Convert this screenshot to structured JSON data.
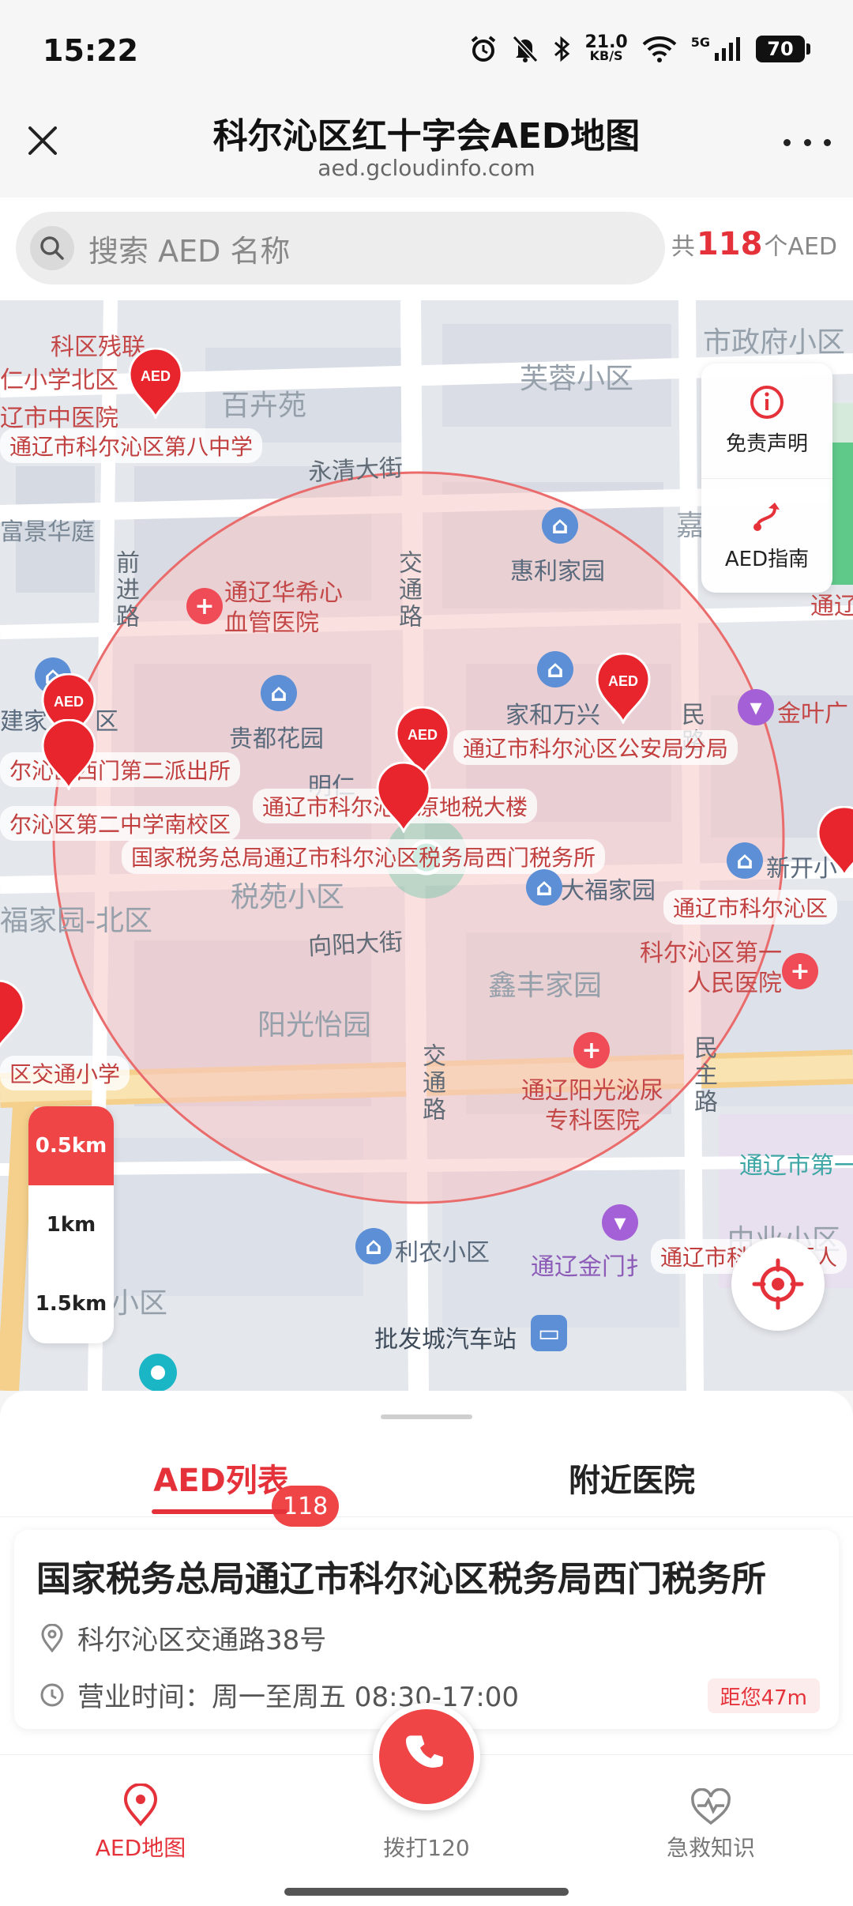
{
  "status_bar": {
    "time": "15:22",
    "net_speed_value": "21.0",
    "net_speed_unit": "KB/S",
    "network": "5G",
    "battery": "70",
    "icons": [
      "alarm-icon",
      "mute-icon",
      "bluetooth-icon",
      "wifi-icon",
      "signal-icon",
      "battery-icon"
    ]
  },
  "header": {
    "title": "科尔沁区红十字会AED地图",
    "url": "aed.gcloudinfo.com"
  },
  "search": {
    "placeholder": "搜索 AED 名称",
    "count_prefix": "共",
    "count": "118",
    "count_suffix": "个AED"
  },
  "map": {
    "labels": {
      "kequ_canlian": "科区残联",
      "ren_xiaoxue": "仁小学北区",
      "zhongyiyuan": "辽市中医院",
      "bazhong": "通辽市科尔沁区第八中学",
      "baihuiyuan": "百卉苑",
      "furong": "芙蓉小区",
      "shizhengfu": "市政府小区",
      "yongqing": "永清大街",
      "fujing": "富景华庭",
      "qianjinlu": "前进路",
      "jiaotonglu_1": "交通路",
      "huili": "惠利家园",
      "jia": "嘉",
      "tongliao_right": "通辽",
      "huaxi_hospital": "通辽华希心血管医院",
      "jiahe": "家和万兴",
      "minlu": "民路",
      "jinyeguang": "金叶广",
      "jianjia": "建家",
      "guidu": "贵都花园",
      "chaqu": "区",
      "ximen_pcs": "尔沁区西门第二派出所",
      "gongan": "通辽市科尔沁区公安局分局",
      "erzhong": "尔沁区第二中学南校区",
      "didashui": "通辽市科尔沁区原地税大楼",
      "mingren": "明仁",
      "shuiwusuo": "国家税务总局通辽市科尔沁区税务局西门税务所",
      "xinkai": "新开小",
      "shuiyuan": "税苑小区",
      "dafu": "大福家园",
      "fujia_north": "福家园-北区",
      "kerqin_right": "通辽市科尔沁区",
      "xiangyang": "向阳大街",
      "diyi_hospital": "科尔沁区第一人民医院",
      "xinfeng": "鑫丰家园",
      "yangguangyi": "阳光怡园",
      "jiaotong_xiaoxue": "区交通小学",
      "jiaotonglu_2": "交通路",
      "minzhulu": "民主路",
      "miniao": "通辽阳光泌尿专科医院",
      "tongliao_di": "通辽市第一",
      "youyi": "由业小区",
      "linong": "利农小区",
      "jinmen": "通辽金门扌",
      "kerqin_ren": "通辽市科尔沁区人",
      "pifa": "批发城汽车站",
      "xiaoqu_left": "小区"
    },
    "side_panel": {
      "disclaimer": "免责声明",
      "guide": "AED指南"
    },
    "ranges": [
      "0.5km",
      "1km",
      "1.5km"
    ],
    "active_range": "0.5km",
    "pin_label": "AED",
    "colors": {
      "accent": "#E5323A",
      "circle_fill": "#F7C7C7",
      "road": "#FFFFFF",
      "highway": "#F9D48A"
    }
  },
  "sheet": {
    "tabs": [
      "AED列表",
      "附近医院"
    ],
    "active_tab": "AED列表",
    "badge": "118",
    "item": {
      "name": "国家税务总局通辽市科尔沁区税务局西门税务所",
      "address": "科尔沁区交通路38号",
      "hours": "营业时间：周一至周五 08:30-17:00",
      "distance": "距您47m"
    }
  },
  "nav": {
    "aed_map": "AED地图",
    "call": "拨打120",
    "knowledge": "急救知识"
  }
}
